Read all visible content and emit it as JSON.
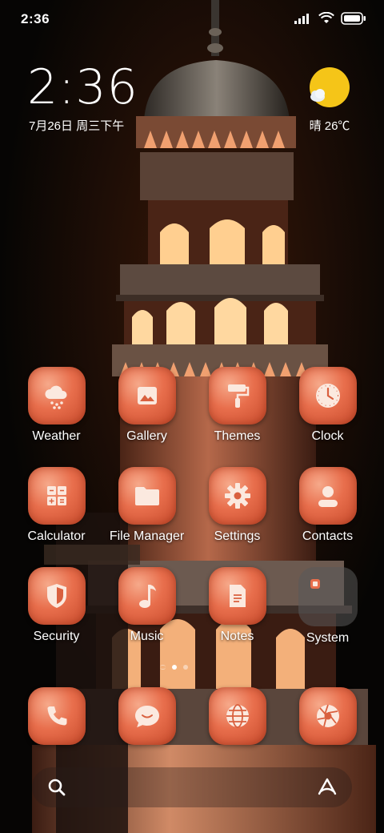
{
  "status_bar": {
    "time": "2:36",
    "icons": [
      "signal-icon",
      "wifi-icon",
      "battery-icon"
    ]
  },
  "clock_widget": {
    "time": "2:36",
    "date": "7月26日 周三下午"
  },
  "weather_widget": {
    "condition_icon": "sunny-partly-cloudy-icon",
    "text": "晴 26℃"
  },
  "apps": [
    [
      {
        "label": "Weather",
        "icon": "weather-cloud-icon"
      },
      {
        "label": "Gallery",
        "icon": "gallery-icon"
      },
      {
        "label": "Themes",
        "icon": "paint-roller-icon"
      },
      {
        "label": "Clock",
        "icon": "clock-icon"
      }
    ],
    [
      {
        "label": "Calculator",
        "icon": "calculator-icon"
      },
      {
        "label": "File Manager",
        "icon": "folder-icon"
      },
      {
        "label": "Settings",
        "icon": "gear-icon"
      },
      {
        "label": "Contacts",
        "icon": "contact-icon"
      }
    ],
    [
      {
        "label": "Security",
        "icon": "shield-icon"
      },
      {
        "label": "Music",
        "icon": "music-note-icon"
      },
      {
        "label": "Notes",
        "icon": "note-icon"
      },
      {
        "label": "System",
        "icon": "system-folder-icon"
      }
    ]
  ],
  "page_indicator": {
    "pages": 2,
    "current": 1
  },
  "dock": [
    {
      "icon": "phone-icon"
    },
    {
      "icon": "message-icon"
    },
    {
      "icon": "browser-globe-icon"
    },
    {
      "icon": "camera-aperture-icon"
    }
  ],
  "search_bar": {
    "left_icon": "search-icon",
    "right_icon": "assistant-icon"
  },
  "colors": {
    "icon_tile": "#e86e4c",
    "icon_glyph": "#fbe9df",
    "sun": "#f5c518"
  }
}
